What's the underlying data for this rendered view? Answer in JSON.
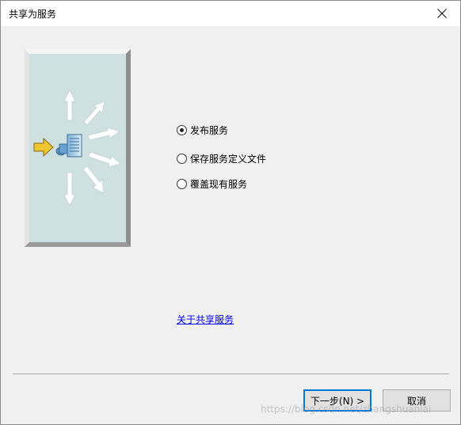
{
  "window": {
    "title": "共享为服务",
    "close_glyph": "✕"
  },
  "options": {
    "items": [
      {
        "label": "发布服务",
        "checked": true
      },
      {
        "label": "保存服务定义文件",
        "checked": false
      },
      {
        "label": "覆盖现有服务",
        "checked": false
      }
    ]
  },
  "link": {
    "about_label": "关于共享服务"
  },
  "buttons": {
    "next_label": "下一步(N) >",
    "cancel_label": "取消"
  },
  "watermark": {
    "text": "https://blog.csdn.net/zhangshuanlai"
  },
  "colors": {
    "banner_fill": "#cfe0e0",
    "link": "#0000ee",
    "focus_border": "#0078d7",
    "arrow_yellow": "#f0c630"
  }
}
